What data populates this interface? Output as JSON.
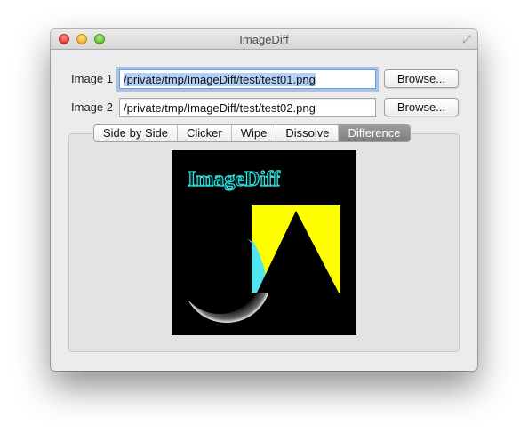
{
  "window": {
    "title": "ImageDiff"
  },
  "form": {
    "image1": {
      "label": "Image 1",
      "value": "/private/tmp/ImageDiff/test/test01.png",
      "button": "Browse..."
    },
    "image2": {
      "label": "Image 2",
      "value": "/private/tmp/ImageDiff/test/test02.png",
      "button": "Browse..."
    }
  },
  "tabs": [
    {
      "label": "Side by Side",
      "active": false
    },
    {
      "label": "Clicker",
      "active": false
    },
    {
      "label": "Wipe",
      "active": false
    },
    {
      "label": "Dissolve",
      "active": false
    },
    {
      "label": "Difference",
      "active": true
    }
  ],
  "diff_image": {
    "text": "ImageDiff",
    "colors": {
      "background": "#000000",
      "text": "#2ee6e6",
      "square": "#ffff00",
      "triangle": "#000000",
      "highlight": "#4ee8ee"
    }
  }
}
